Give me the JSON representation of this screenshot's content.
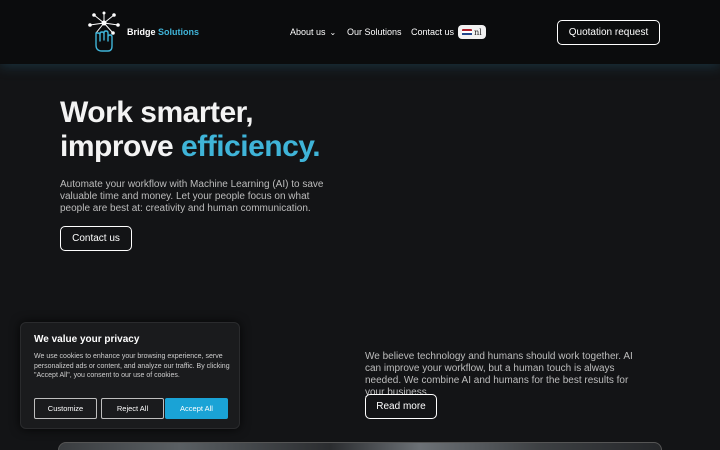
{
  "header": {
    "brand_name": "Bridge",
    "brand_accent": "Solutions",
    "nav": {
      "about": "About us",
      "solutions": "Our Solutions",
      "contact": "Contact us"
    },
    "language": "nl",
    "quote_button": "Quotation request"
  },
  "hero": {
    "title_line1": "Work smarter,",
    "title_line2_prefix": "improve ",
    "title_line2_accent": "efficiency.",
    "description": "Automate your workflow with Machine Learning (AI) to save valuable time and money. Let your people focus on what people are best at: creativity and human communication.",
    "button": "Contact us"
  },
  "section": {
    "description": "We believe technology and humans should work together. AI can improve your workflow, but a human touch is always needed. We combine AI and humans for the best results for your business.",
    "button": "Read more"
  },
  "cookie": {
    "title": "We value your privacy",
    "text": "We use cookies to enhance your browsing experience, serve personalized ads or content, and analyze our traffic. By clicking \"Accept All\", you consent to our use of cookies.",
    "customize": "Customize",
    "reject": "Reject All",
    "accept": "Accept All"
  },
  "colors": {
    "accent": "#3fb4d8",
    "accept_button": "#1aa3d6",
    "background": "#131416"
  },
  "icons": {
    "logo": "network-hand-logo-icon",
    "about_dropdown": "chevron-down-icon",
    "language_flag": "netherlands-flag-icon"
  }
}
